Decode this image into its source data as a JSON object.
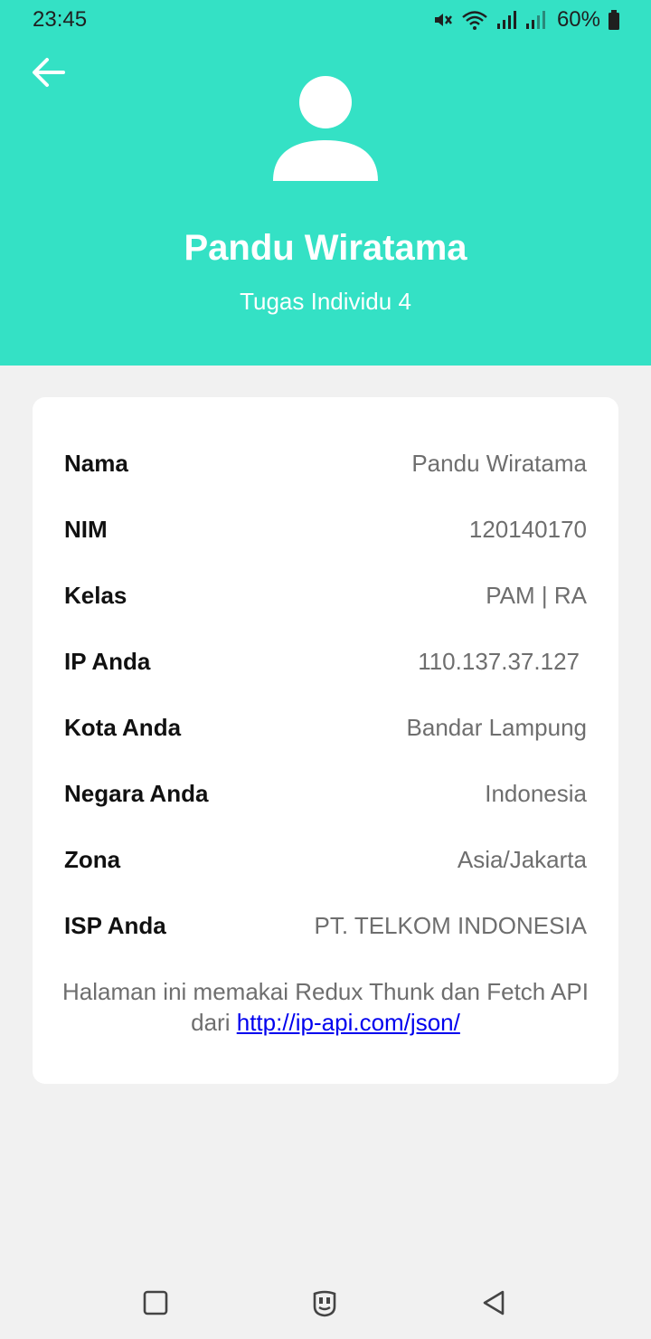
{
  "status_bar": {
    "time": "23:45",
    "battery_percent": "60%",
    "icons": [
      "mute-icon",
      "wifi-icon",
      "signal-icon",
      "signal-icon",
      "battery-icon"
    ]
  },
  "header": {
    "background_color": "#34e1c5",
    "back_icon": "arrow-left-icon",
    "avatar_icon": "user-icon",
    "name": "Pandu Wiratama",
    "subtitle": "Tugas Individu 4"
  },
  "info": {
    "rows": [
      {
        "label": "Nama",
        "value": "Pandu Wiratama"
      },
      {
        "label": "NIM",
        "value": "120140170"
      },
      {
        "label": "Kelas",
        "value": "PAM | RA"
      },
      {
        "label": "IP Anda",
        "value": "110.137.37.127"
      },
      {
        "label": "Kota Anda",
        "value": "Bandar Lampung"
      },
      {
        "label": "Negara Anda",
        "value": "Indonesia"
      },
      {
        "label": "Zona",
        "value": "Asia/Jakarta"
      },
      {
        "label": "ISP Anda",
        "value": "PT. TELKOM INDONESIA"
      }
    ],
    "footer_text": "Halaman ini memakai Redux Thunk dan Fetch API dari",
    "footer_link": "http://ip-api.com/json/"
  },
  "nav_bar": {
    "buttons": [
      "recent-apps-icon",
      "home-icon",
      "back-triangle-icon"
    ]
  }
}
